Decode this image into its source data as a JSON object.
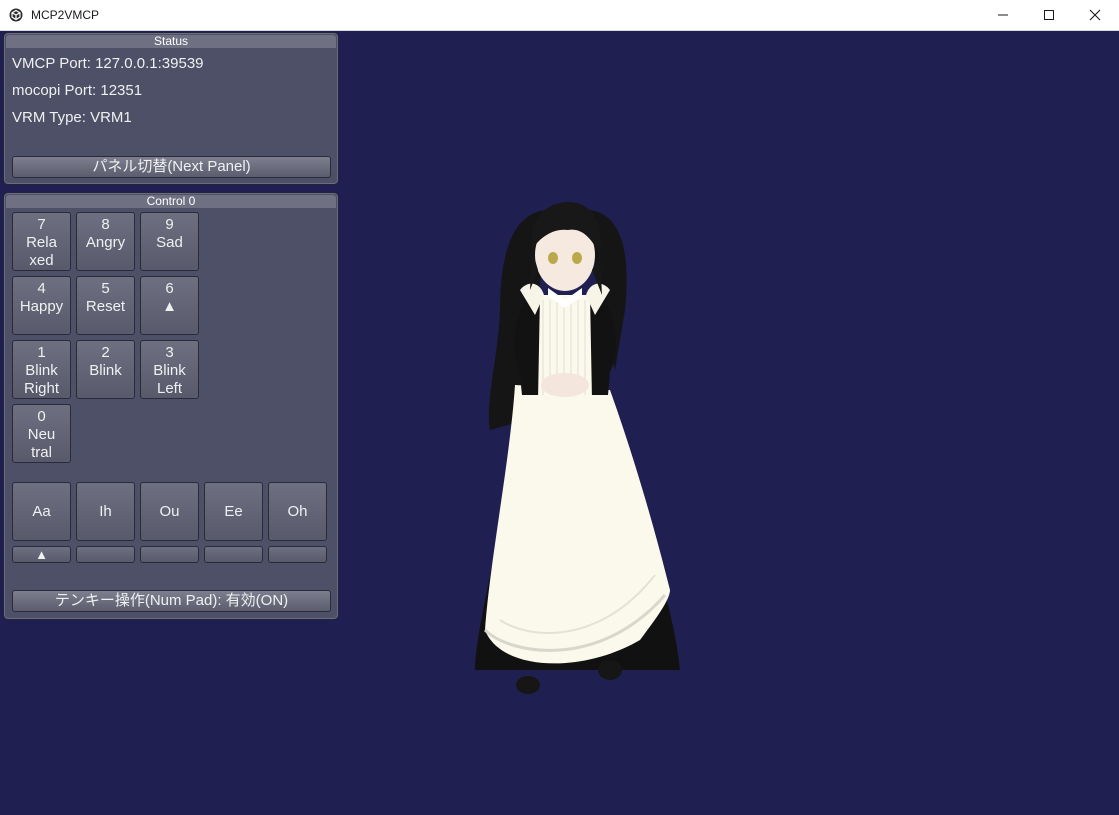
{
  "window": {
    "title": "MCP2VMCP"
  },
  "status_panel": {
    "title": "Status",
    "vmcp_port": "VMCP Port: 127.0.0.1:39539",
    "mocopi_port": "mocopi Port: 12351",
    "vrm_type": "VRM Type: VRM1",
    "next_panel_button": "パネル切替(Next Panel)"
  },
  "control_panel": {
    "title": "Control 0",
    "keys": [
      {
        "num": "7",
        "line1": "Rela",
        "line2": "xed"
      },
      {
        "num": "8",
        "line1": "Angry",
        "line2": ""
      },
      {
        "num": "9",
        "line1": "Sad",
        "line2": ""
      },
      {
        "num": "4",
        "line1": "Happy",
        "line2": ""
      },
      {
        "num": "5",
        "line1": "Reset",
        "line2": ""
      },
      {
        "num": "6",
        "line1": "▲",
        "line2": ""
      },
      {
        "num": "1",
        "line1": "Blink",
        "line2": "Right"
      },
      {
        "num": "2",
        "line1": "Blink",
        "line2": ""
      },
      {
        "num": "3",
        "line1": "Blink",
        "line2": "Left"
      },
      {
        "num": "0",
        "line1": "Neu",
        "line2": "tral"
      }
    ],
    "visemes": [
      "Aa",
      "Ih",
      "Ou",
      "Ee",
      "Oh"
    ],
    "viseme_sliders": [
      "▲",
      "",
      "",
      "",
      ""
    ],
    "numpad_button": "テンキー操作(Num Pad): 有効(ON)"
  },
  "colors": {
    "background": "#1f2051",
    "panel": "#4d5066",
    "panel_title": "#6f7183"
  },
  "icons": {
    "app": "unity-cube-icon",
    "minimize": "minimize-icon",
    "maximize": "maximize-icon",
    "close": "close-icon"
  }
}
